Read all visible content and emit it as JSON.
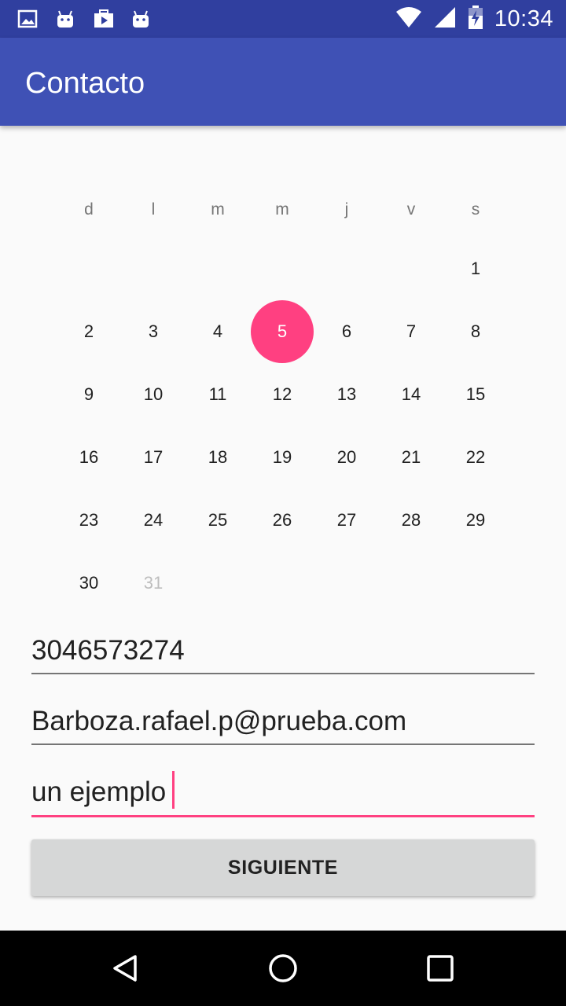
{
  "status_bar": {
    "time": "10:34",
    "left_icons": [
      "image-icon",
      "android-icon",
      "play-store-icon",
      "android-icon"
    ],
    "right_icons": [
      "wifi-icon",
      "signal-icon",
      "battery-charging-icon"
    ]
  },
  "app_bar": {
    "title": "Contacto"
  },
  "calendar": {
    "weekdays": [
      "d",
      "l",
      "m",
      "m",
      "j",
      "v",
      "s"
    ],
    "weeks": [
      [
        "",
        "",
        "",
        "",
        "",
        "",
        "1"
      ],
      [
        "2",
        "3",
        "4",
        "5",
        "6",
        "7",
        "8"
      ],
      [
        "9",
        "10",
        "11",
        "12",
        "13",
        "14",
        "15"
      ],
      [
        "16",
        "17",
        "18",
        "19",
        "20",
        "21",
        "22"
      ],
      [
        "23",
        "24",
        "25",
        "26",
        "27",
        "28",
        "29"
      ],
      [
        "30",
        "31",
        "",
        "",
        "",
        "",
        ""
      ]
    ],
    "selected_day": "5",
    "disabled_days": [
      "31"
    ],
    "accent_color": "#ff4081"
  },
  "form": {
    "phone_value": "3046573274",
    "email_value": "Barboza.rafael.p@prueba.com",
    "description_value": "un ejemplo"
  },
  "button": {
    "label": "SIGUIENTE"
  },
  "nav_bar": {
    "icons": [
      "back-icon",
      "home-icon",
      "recents-icon"
    ]
  },
  "colors": {
    "status_bar": "#303f9f",
    "app_bar": "#3f51b5",
    "accent": "#ff4081"
  }
}
